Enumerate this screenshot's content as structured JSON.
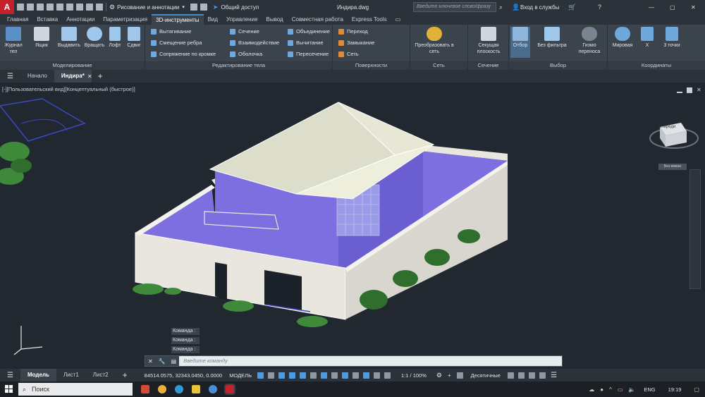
{
  "titlebar": {
    "workspace": "Рисование и аннотации",
    "share": "Общий доступ",
    "filename": "Индира.dwg",
    "search_placeholder": "Введите ключевое слово/фразу",
    "signin": "Вход в службы"
  },
  "menu_tabs": [
    "Главная",
    "Вставка",
    "Аннотации",
    "Параметризация",
    "3D-инструменты",
    "Вид",
    "Управление",
    "Вывод",
    "Совместная работа",
    "Express Tools"
  ],
  "ribbon": {
    "modeling": {
      "title": "Моделирование",
      "buttons": [
        "Журнал тел",
        "Ящик",
        "Выдавить",
        "Вращать",
        "Лофт",
        "Сдвиг"
      ]
    },
    "solid_editing": {
      "title": "Редактирование тела",
      "items": [
        "Вытягивание",
        "Смещение ребра",
        "Сопряжение по кромке",
        "Сечение",
        "Взаимодействие",
        "Оболочка",
        "Объединение",
        "Вычитание",
        "Пересечение"
      ]
    },
    "surfaces": {
      "title": "Поверхности",
      "items": [
        "Переход",
        "Замыкание",
        "Сеть"
      ]
    },
    "mesh": {
      "title": "Сеть",
      "button": "Преобразовать в сеть"
    },
    "section": {
      "title": "Сечение",
      "button": "Секущая плоскость"
    },
    "selection": {
      "title": "Выбор",
      "buttons": [
        "Отбор",
        "Без фильтра",
        "Гизмо переноса"
      ]
    },
    "coordinates": {
      "title": "Координаты",
      "buttons": [
        "Мировая",
        "X",
        "3 точки"
      ]
    }
  },
  "file_tabs": {
    "start": "Начало",
    "drawing": "Индира*"
  },
  "viewport": {
    "label": "[-][Пользовательский вид][Концептуальный (быстрое)]",
    "viewcube_face": "Спереди",
    "wcs": "Без имени"
  },
  "command": {
    "history": [
      "Команда :",
      "Команда :",
      "Команда :"
    ],
    "placeholder": "Введите команду"
  },
  "status": {
    "layouts": [
      "Модель",
      "Лист1",
      "Лист2"
    ],
    "coords": "84514.0575, 32343.0450, 0.0000",
    "mode": "МОДЕЛЬ",
    "scale": "1:1 / 100%",
    "units": "Десятичные"
  },
  "taskbar": {
    "search": "Поиск",
    "lang": "ENG",
    "time": "19:19"
  },
  "colors": {
    "accent": "#3e8ed0",
    "wall_white": "#e8e6df",
    "wall_purple": "#7d6fe0",
    "grass": "#3e8a3a"
  }
}
